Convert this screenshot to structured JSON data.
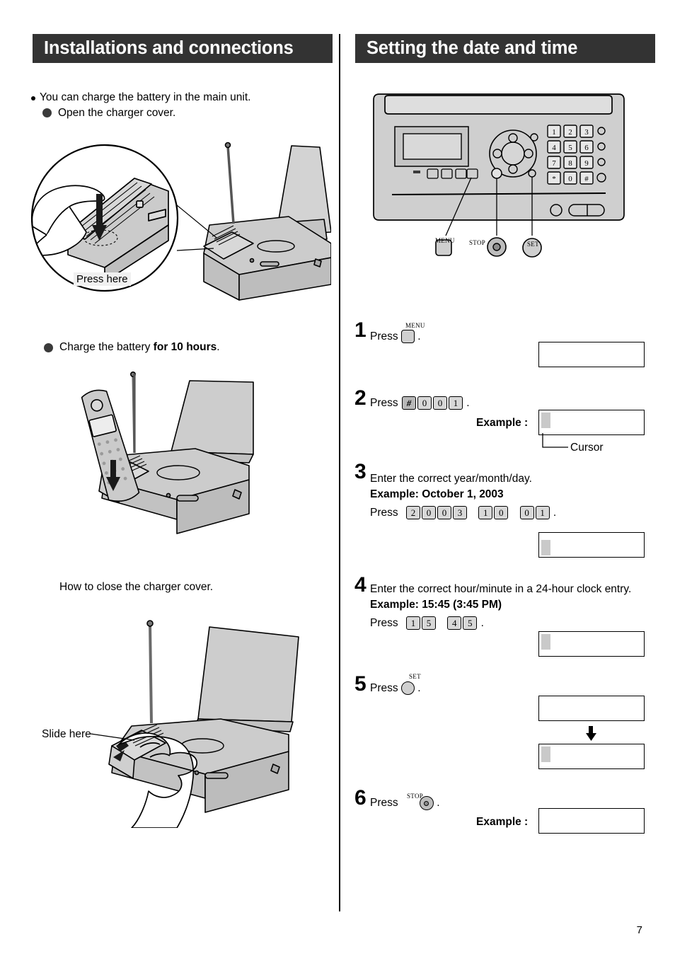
{
  "page": {
    "number": "7"
  },
  "left": {
    "header": "Installations and connections",
    "intro": "You can charge the battery in the main unit.",
    "step_open": "Open the charger cover.",
    "press_here": "Press here",
    "charge_text_1": "Charge the battery ",
    "charge_text_bold": "for 10 hours",
    "charge_text_2": ".",
    "how_to_close": "How to close the charger cover.",
    "slide_here": "Slide here"
  },
  "right": {
    "header": "Setting the date and time",
    "panel": {
      "menu_label": "MENU",
      "stop_label": "STOP",
      "set_label": "SET",
      "keys": [
        "1",
        "2",
        "3",
        "4",
        "5",
        "6",
        "7",
        "8",
        "9",
        "*",
        "0",
        "#"
      ]
    },
    "cursor_label": "Cursor",
    "example_label": "Example :",
    "steps": [
      {
        "num": "1",
        "press": "Press",
        "button": "menu-button",
        "button_label": "MENU",
        "period": "."
      },
      {
        "num": "2",
        "press": "Press",
        "keys": [
          "#",
          "0",
          "0",
          "1"
        ],
        "period": ".",
        "example_label": "Example :",
        "cursor_label": "Cursor"
      },
      {
        "num": "3",
        "line1": "Enter the correct year/month/day.",
        "line2": "Example: October 1, 2003",
        "press": "Press",
        "key_groups": [
          [
            "2",
            "0",
            "0",
            "3"
          ],
          [
            "1",
            "0"
          ],
          [
            "0",
            "1"
          ]
        ],
        "period": "."
      },
      {
        "num": "4",
        "line1": "Enter the correct hour/minute in a 24-hour clock entry.",
        "line2": "Example: 15:45 (3:45 PM)",
        "press": "Press",
        "key_groups": [
          [
            "1",
            "5"
          ],
          [
            "4",
            "5"
          ]
        ],
        "period": "."
      },
      {
        "num": "5",
        "press": "Press",
        "button": "set-button",
        "button_label": "SET",
        "period": "."
      },
      {
        "num": "6",
        "press": "Press",
        "button": "stop-button",
        "button_label": "STOP",
        "period": ".",
        "example_label": "Example :"
      }
    ]
  },
  "colors": {
    "header_bg": "#333333",
    "header_text": "#ffffff",
    "illustration_fill": "#c9c9c9",
    "illustration_light": "#dcdcdc",
    "cursor": "#c9c9c9"
  }
}
